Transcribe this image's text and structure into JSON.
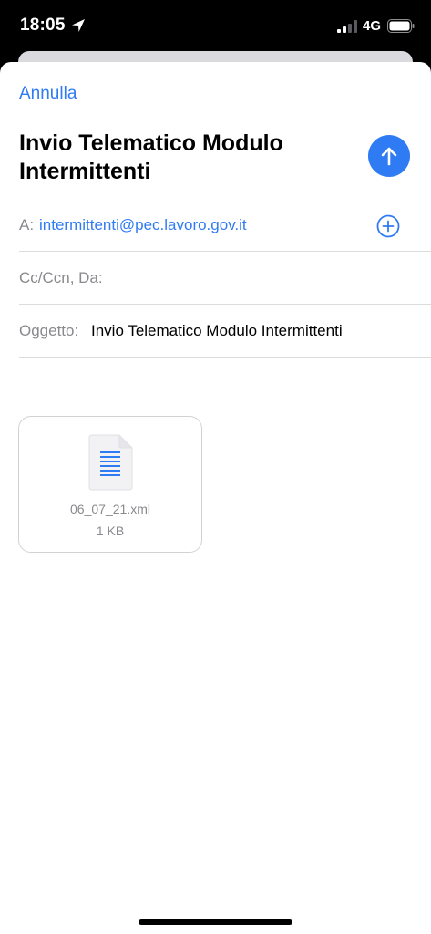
{
  "status_bar": {
    "time": "18:05",
    "network": "4G",
    "icons": [
      "location-arrow-icon",
      "signal-bars-icon",
      "battery-icon"
    ]
  },
  "compose": {
    "cancel_label": "Annulla",
    "title": "Invio Telematico Modulo Intermittenti",
    "send_icon": "arrow-up-icon",
    "to": {
      "label": "A:",
      "value": "intermittenti@pec.lavoro.gov.it",
      "add_icon": "plus-circle-icon"
    },
    "cc": {
      "label": "Cc/Ccn, Da:"
    },
    "subject": {
      "label": "Oggetto:",
      "value": "Invio Telematico Modulo Intermittenti"
    },
    "attachment": {
      "icon": "document-icon",
      "name": "06_07_21.xml",
      "size": "1 KB"
    }
  },
  "colors": {
    "accent": "#2f7bf3",
    "label_gray": "#8a8a8e",
    "divider": "#dcdce0"
  }
}
